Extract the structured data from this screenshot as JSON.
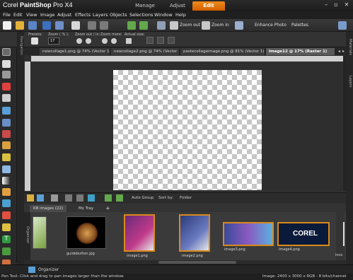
{
  "app": {
    "brand": "Corel",
    "product": "PaintShop",
    "edition": "Pro X4",
    "workspace_tabs": [
      "Manage",
      "Adjust",
      "Edit"
    ]
  },
  "menu": [
    "File",
    "Edit",
    "View",
    "Image",
    "Adjust",
    "Effects",
    "Layers",
    "Objects",
    "Selections",
    "Window",
    "Help"
  ],
  "toolbar": {
    "zoom_out": "Zoom out",
    "zoom_in": "Zoom in",
    "enhance_photo": "Enhance Photo",
    "palettes": "Palettes"
  },
  "tool_options": {
    "presets": "Presets:",
    "zoom_pct": "Zoom ( % ):",
    "zoom_value": "17",
    "zoom_out_in": "Zoom out / in:",
    "zoom_more": "Zoom more:",
    "actual_size": "Actual size:"
  },
  "documents": [
    {
      "label": "newcollage1.png @  74% (Vector 1)"
    },
    {
      "label": "newcollage2.png @  74% (Vector 1)"
    },
    {
      "label": "pastecollageimage.png @  81% (Vector 1)"
    },
    {
      "label": "Image12 @  17% (Raster 1)"
    }
  ],
  "side_labels": {
    "left": "Navigation",
    "right_top": "Materials",
    "right_bottom": "Layers"
  },
  "organizer": {
    "auto_group": "Auto Group",
    "sort_by": "Sort by:",
    "sort_value": "Folder",
    "tabs": [
      "KB images (22)",
      "My Tray",
      "+"
    ],
    "side_label": "Organizer",
    "bottom_tab": "Organizer",
    "thumbnails": [
      {
        "label": ""
      },
      {
        "label": "guidebutton.jpg"
      },
      {
        "label": "image1.png"
      },
      {
        "label": "image2.png"
      },
      {
        "label": "image3.png"
      },
      {
        "label": "image4.png"
      },
      {
        "label": "inco"
      }
    ],
    "corel_logo_text": "COREL"
  },
  "status": {
    "left": "Pan Tool: Click and drag to pan images larger than the window.",
    "right": "Image:  2400 x 3000 x RGB - 8 bits/channel"
  },
  "colors": {
    "accent": "#e07a10",
    "background": "#2f2f2f"
  }
}
